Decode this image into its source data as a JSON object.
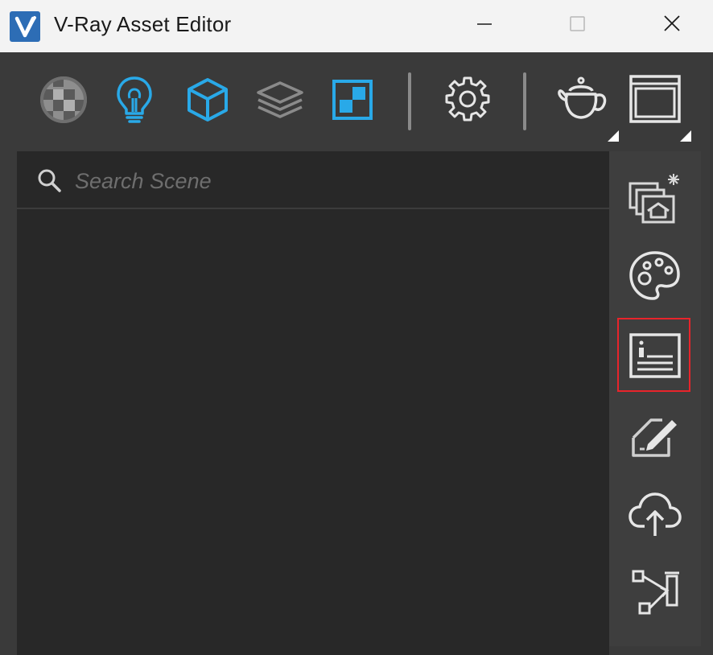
{
  "window": {
    "title": "V-Ray Asset Editor",
    "controls": [
      "minimize",
      "maximize",
      "close"
    ]
  },
  "toolbar": {
    "items": [
      {
        "name": "materials",
        "icon": "materials-sphere-icon",
        "active": false
      },
      {
        "name": "lights",
        "icon": "light-bulb-icon",
        "active": true
      },
      {
        "name": "geometry",
        "icon": "cube-icon",
        "active": true
      },
      {
        "name": "render-elements",
        "icon": "layers-icon",
        "active": false
      },
      {
        "name": "textures",
        "icon": "texture-checker-icon",
        "active": true
      },
      {
        "name": "settings",
        "icon": "gear-icon",
        "active": false
      },
      {
        "name": "render",
        "icon": "teapot-icon",
        "active": false
      },
      {
        "name": "frame-buffer",
        "icon": "frame-buffer-window-icon",
        "active": false
      }
    ],
    "accent_color": "#29a9e8"
  },
  "search": {
    "placeholder": "Search Scene",
    "value": ""
  },
  "sidebar": {
    "items": [
      {
        "name": "create-asset",
        "icon": "create-asset-icon"
      },
      {
        "name": "material-library",
        "icon": "palette-icon"
      },
      {
        "name": "asset-info",
        "icon": "info-panel-icon",
        "highlighted": true
      },
      {
        "name": "edit-asset",
        "icon": "edit-pencil-icon"
      },
      {
        "name": "upload-cloud",
        "icon": "cloud-upload-icon"
      },
      {
        "name": "node-editor",
        "icon": "node-graph-icon"
      }
    ],
    "highlight_color": "#e8242b"
  }
}
